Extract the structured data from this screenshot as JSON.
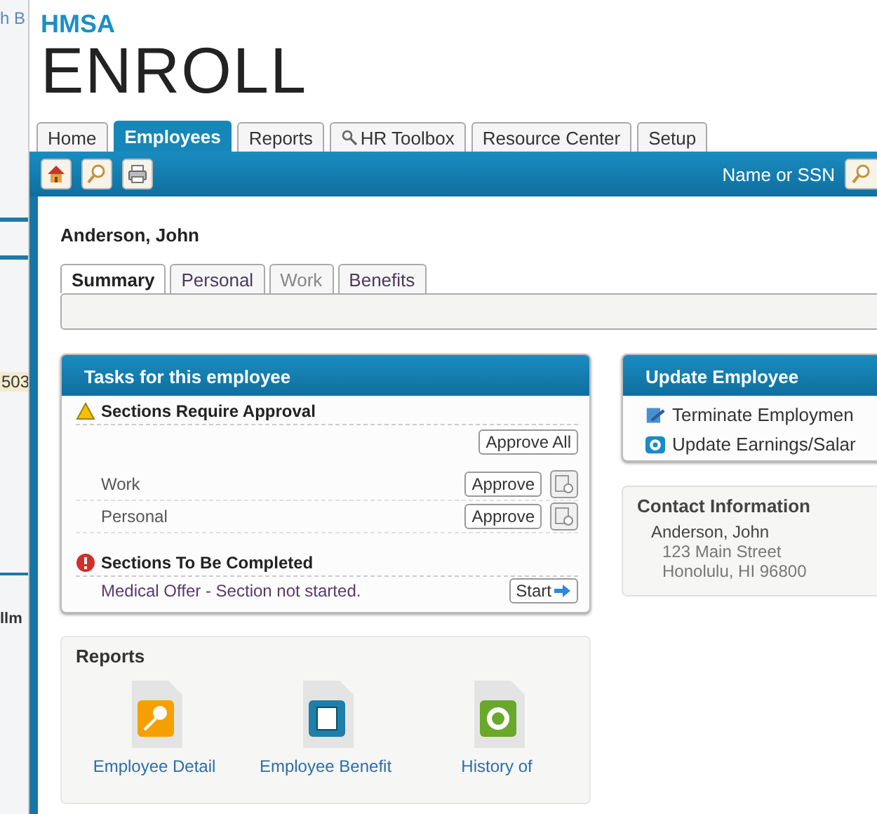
{
  "background_window": {
    "fragments": [
      "h B",
      "503",
      "llm"
    ]
  },
  "logo": {
    "brand": "HMSA",
    "product": "ENROLL"
  },
  "tabs": [
    {
      "label": "Home",
      "selected": false,
      "has_icon": false
    },
    {
      "label": "Employees",
      "selected": true,
      "has_icon": false
    },
    {
      "label": "Reports",
      "selected": false,
      "has_icon": false
    },
    {
      "label": "HR Toolbox",
      "selected": false,
      "has_icon": true
    },
    {
      "label": "Resource Center",
      "selected": false,
      "has_icon": false
    },
    {
      "label": "Setup",
      "selected": false,
      "has_icon": false
    }
  ],
  "toolbar": {
    "search_label": "Name or SSN"
  },
  "employee": {
    "name": "Anderson, John"
  },
  "subtabs": [
    {
      "label": "Summary",
      "selected": true,
      "disabled": false
    },
    {
      "label": "Personal",
      "selected": false,
      "disabled": false
    },
    {
      "label": "Work",
      "selected": false,
      "disabled": true
    },
    {
      "label": "Benefits",
      "selected": false,
      "disabled": false
    }
  ],
  "tasks": {
    "title": "Tasks for this employee",
    "approval": {
      "heading": "Sections Require Approval",
      "approve_all": "Approve All",
      "items": [
        {
          "label": "Work",
          "button": "Approve"
        },
        {
          "label": "Personal",
          "button": "Approve"
        }
      ]
    },
    "incomplete": {
      "heading": "Sections To Be Completed",
      "items": [
        {
          "label": "Medical Offer - Section not started.",
          "button": "Start"
        }
      ]
    }
  },
  "update_employee": {
    "title": "Update Employee",
    "links": [
      {
        "label": "Terminate Employmen",
        "kind": "terminate"
      },
      {
        "label": "Update Earnings/Salar",
        "kind": "earnings"
      }
    ]
  },
  "contact": {
    "title": "Contact Information",
    "name": "Anderson, John",
    "lines": [
      "123 Main Street",
      "Honolulu, HI 96800"
    ]
  },
  "reports": {
    "title": "Reports",
    "items": [
      {
        "label": "Employee Detail",
        "kind": "search"
      },
      {
        "label": "Employee Benefit",
        "kind": "document"
      },
      {
        "label": "History of",
        "kind": "refresh"
      }
    ]
  }
}
